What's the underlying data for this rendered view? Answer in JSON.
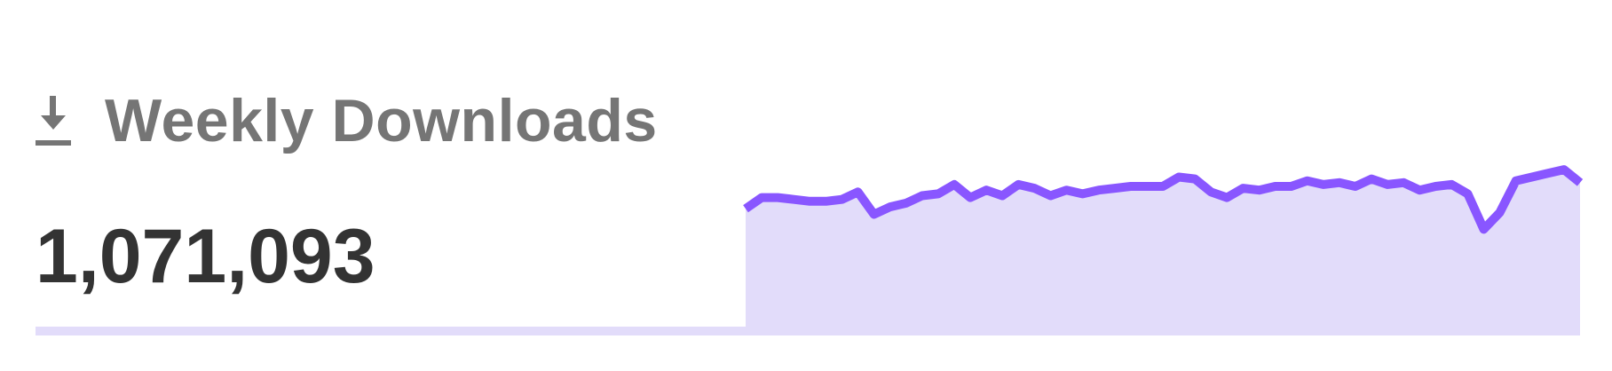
{
  "header": {
    "icon": "download-icon",
    "title": "Weekly Downloads"
  },
  "weekly_downloads": "1,071,093",
  "colors": {
    "accent": "#8956ff",
    "fill": "#e2dcfa",
    "title": "#757575",
    "count": "#333333"
  },
  "chart_data": {
    "type": "area",
    "title": "",
    "xlabel": "",
    "ylabel": "",
    "grid": false,
    "series": [
      {
        "values": [
          68,
          74,
          74,
          73,
          72,
          72,
          73,
          77,
          65,
          69,
          71,
          75,
          76,
          81,
          74,
          78,
          75,
          81,
          79,
          75,
          78,
          76,
          78,
          79,
          80,
          80,
          80,
          85,
          84,
          77,
          74,
          79,
          78,
          80,
          80,
          83,
          81,
          82,
          80,
          84,
          81,
          82,
          78,
          80,
          81,
          76,
          57,
          66,
          83,
          85,
          87,
          89,
          82
        ]
      }
    ],
    "ylim": [
      0,
      100
    ]
  }
}
